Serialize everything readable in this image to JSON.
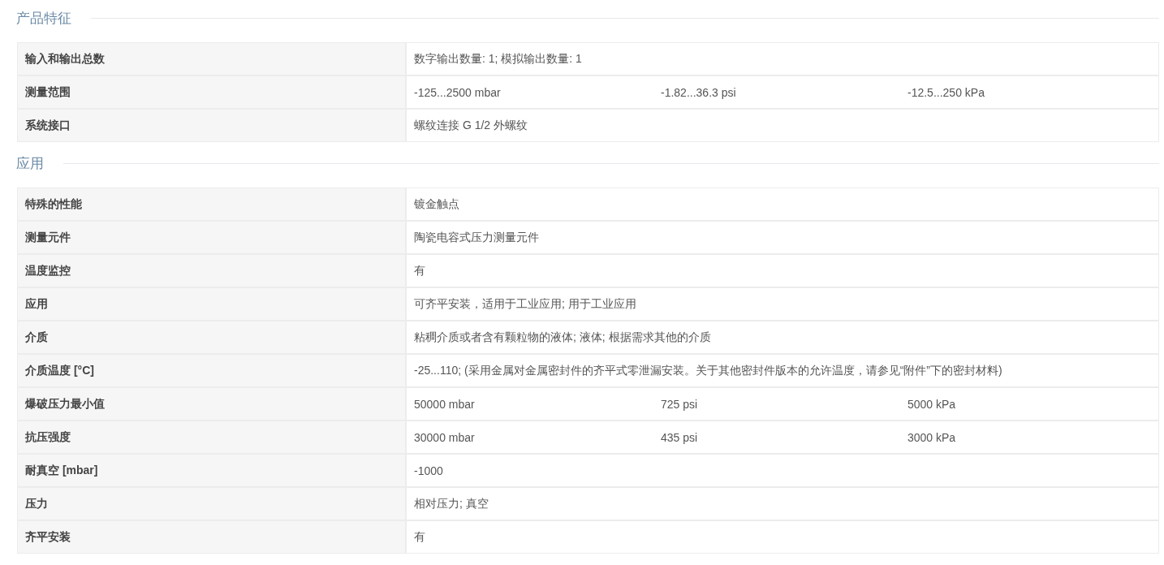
{
  "sections": [
    {
      "title": "产品特征",
      "rows": [
        {
          "label": "输入和输出总数",
          "values": [
            "数字输出数量: 1; 模拟输出数量: 1"
          ]
        },
        {
          "label": "测量范围",
          "values": [
            "-125...2500 mbar",
            "-1.82...36.3 psi",
            "-12.5...250 kPa"
          ]
        },
        {
          "label": "系统接口",
          "values": [
            "螺纹连接 G 1/2 外螺纹"
          ]
        }
      ]
    },
    {
      "title": "应用",
      "rows": [
        {
          "label": "特殊的性能",
          "values": [
            "镀金触点"
          ]
        },
        {
          "label": "测量元件",
          "values": [
            "陶瓷电容式压力测量元件"
          ]
        },
        {
          "label": "温度监控",
          "values": [
            "有"
          ]
        },
        {
          "label": "应用",
          "values": [
            "可齐平安装，适用于工业应用; 用于工业应用"
          ]
        },
        {
          "label": "介质",
          "values": [
            "粘稠介质或者含有颗粒物的液体; 液体; 根据需求其他的介质"
          ]
        },
        {
          "label": "介质温度 [°C]",
          "values": [
            "-25...110; (采用金属对金属密封件的齐平式零泄漏安装。关于其他密封件版本的允许温度，请参见“附件”下的密封材料)"
          ]
        },
        {
          "label": "爆破压力最小值",
          "values": [
            "50000 mbar",
            "725 psi",
            "5000 kPa"
          ]
        },
        {
          "label": "抗压强度",
          "values": [
            "30000 mbar",
            "435 psi",
            "3000 kPa"
          ]
        },
        {
          "label": "耐真空 [mbar]",
          "values": [
            "-1000"
          ]
        },
        {
          "label": "压力",
          "values": [
            "相对压力; 真空"
          ]
        },
        {
          "label": "齐平安装",
          "values": [
            "有"
          ]
        }
      ]
    }
  ]
}
